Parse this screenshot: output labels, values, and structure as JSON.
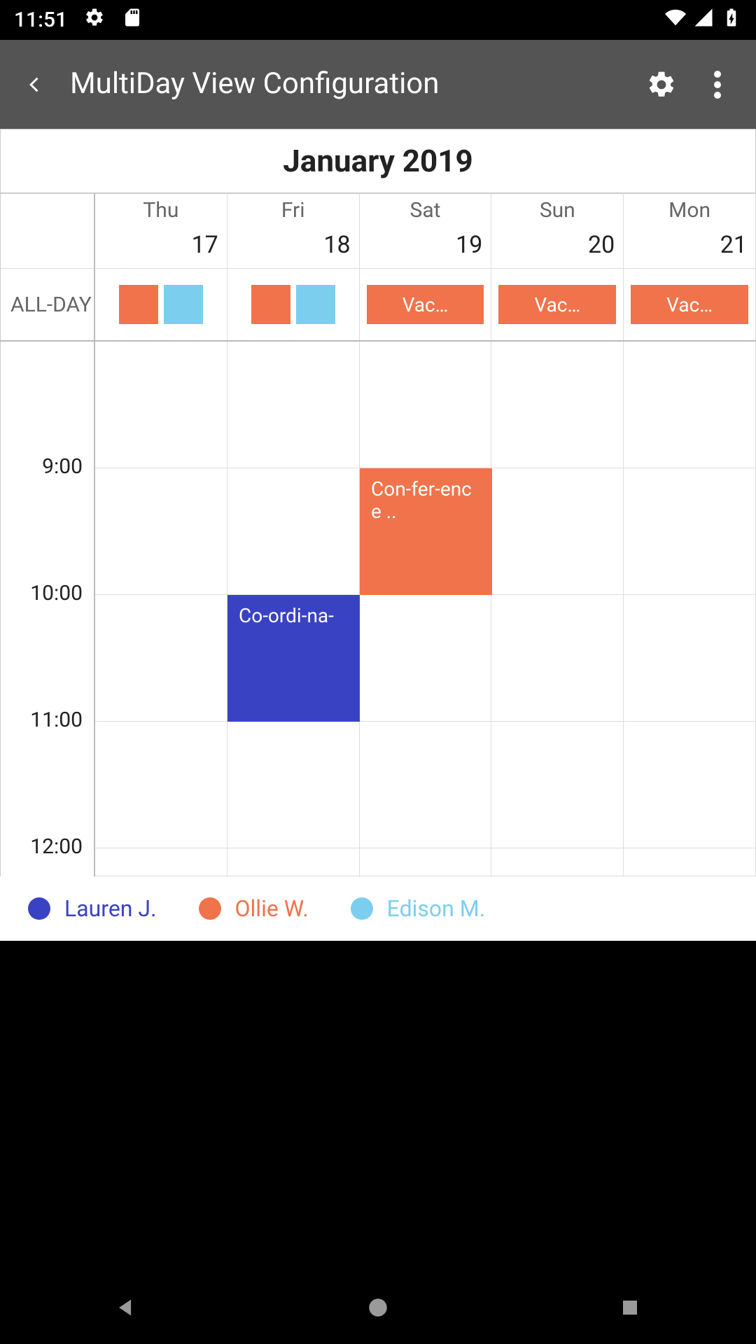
{
  "status": {
    "time": "11:51"
  },
  "appbar": {
    "title": "MultiDay View Configuration"
  },
  "month": "January 2019",
  "days": [
    {
      "name": "Thu",
      "num": "17"
    },
    {
      "name": "Fri",
      "num": "18"
    },
    {
      "name": "Sat",
      "num": "19"
    },
    {
      "name": "Sun",
      "num": "20"
    },
    {
      "name": "Mon",
      "num": "21"
    }
  ],
  "allday_label": "ALL-DAY",
  "allday": {
    "c2_label": "Vac…",
    "c3_label": "Vac…",
    "c4_label": "Vac…"
  },
  "hours": [
    "9:00",
    "10:00",
    "11:00",
    "12:00"
  ],
  "events": {
    "conf": "Con-fer-ence ..",
    "coord": "Co-ordi-na-"
  },
  "legend": [
    {
      "name": "Lauren J.",
      "color": "#3a42c4"
    },
    {
      "name": "Ollie W.",
      "color": "#f0734b"
    },
    {
      "name": "Edison M.",
      "color": "#7cceee"
    }
  ],
  "colors": {
    "orange": "#f0734b",
    "blue": "#3a42c4",
    "sky": "#7cceee"
  }
}
